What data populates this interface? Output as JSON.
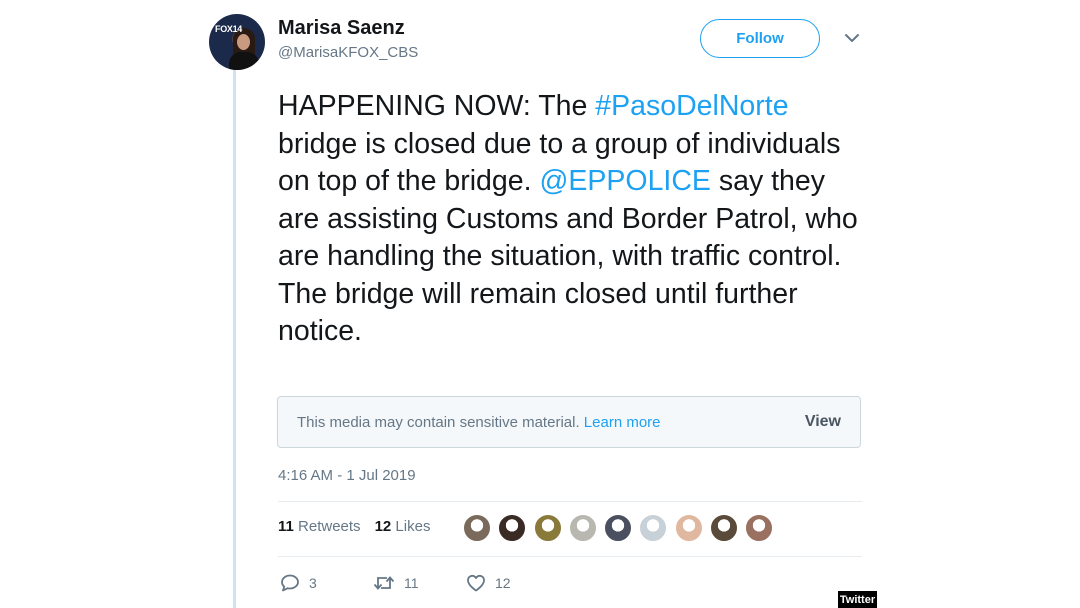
{
  "user": {
    "name": "Marisa Saenz",
    "handle": "@MarisaKFOX_CBS",
    "avatar_logo": "FOX14"
  },
  "follow_label": "Follow",
  "tweet": {
    "seg1": "HAPPENING NOW: The ",
    "hashtag": "#PasoDelNorte",
    "seg2": " bridge is closed due to a group of individuals on top of the bridge. ",
    "mention": "@EPPOLICE",
    "seg3": " say they are assisting Customs and Border Patrol, who are handling the situation, with traffic control. The bridge will remain closed until further notice."
  },
  "sensitive": {
    "message": "This media may contain sensitive material.",
    "learn_more": "Learn more",
    "view": "View"
  },
  "timestamp": "4:16 AM - 1 Jul 2019",
  "stats": {
    "retweets_count": "11",
    "retweets_label": "Retweets",
    "likes_count": "12",
    "likes_label": "Likes"
  },
  "liker_avatar_colors": [
    "#7a6a5c",
    "#3a2a24",
    "#8a7a3a",
    "#b8b8b0",
    "#4a5060",
    "#c8d0d8",
    "#e0b8a0",
    "#5a4a3a",
    "#9a7060"
  ],
  "actions": {
    "replies": "3",
    "retweets": "11",
    "likes": "12"
  },
  "watermark": "Twitter",
  "colors": {
    "accent": "#1da1f2",
    "muted": "#657786",
    "text": "#14171a"
  }
}
